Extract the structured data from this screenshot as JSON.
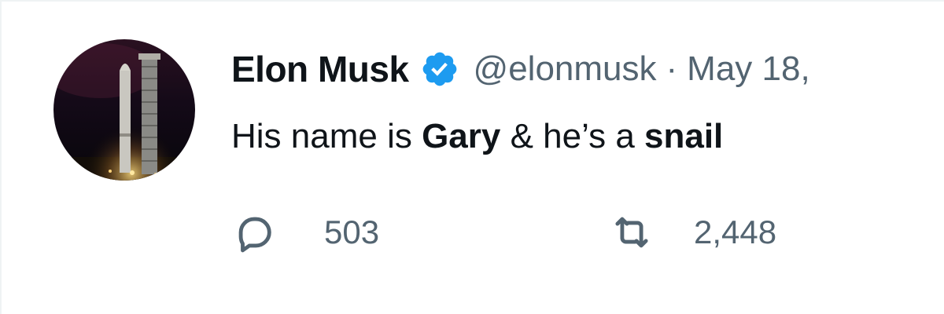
{
  "tweet": {
    "author": {
      "display_name": "Elon Musk",
      "handle": "@elonmusk",
      "verified": true,
      "avatar_icon": "rocket-launch-tower-photo"
    },
    "separator": "·",
    "timestamp": "May 18,",
    "text_parts": {
      "p1": "His name is ",
      "p2": "Gary",
      "p3": " & he’s a ",
      "p4": "snail"
    },
    "actions": {
      "reply": {
        "icon": "reply-icon",
        "count": "503"
      },
      "retweet": {
        "icon": "retweet-icon",
        "count": "2,448"
      }
    }
  },
  "colors": {
    "primary_text": "#0f1419",
    "secondary_text": "#536471",
    "verified_blue": "#1d9bf0",
    "border": "#eff3f4"
  }
}
